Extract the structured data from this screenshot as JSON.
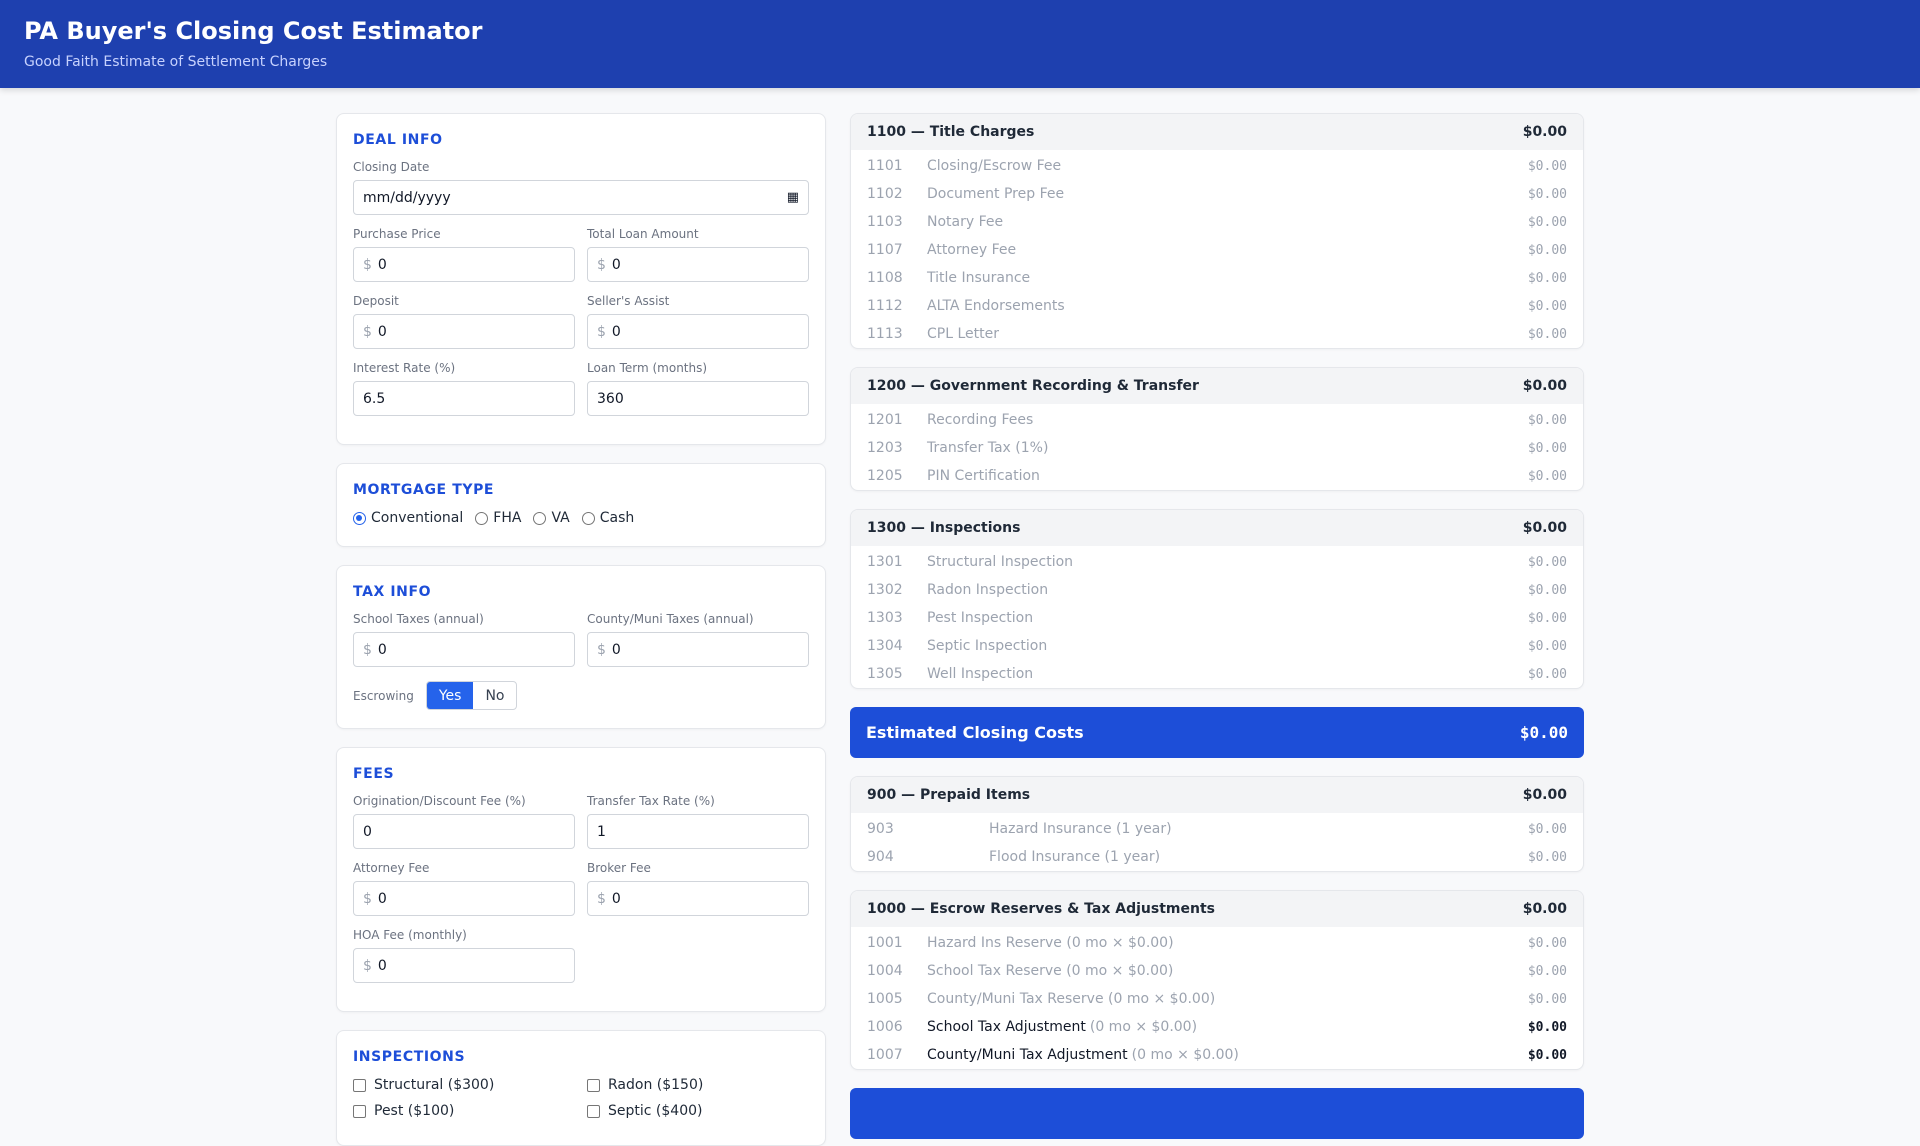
{
  "header": {
    "title": "PA Buyer's Closing Cost Estimator",
    "subtitle": "Good Faith Estimate of Settlement Charges"
  },
  "deal": {
    "heading": "DEAL INFO",
    "closing_date_label": "Closing Date",
    "closing_date_placeholder": "mm/dd/yyyy",
    "fields": [
      {
        "label": "Purchase Price",
        "value": "0",
        "currency": "$"
      },
      {
        "label": "Total Loan Amount",
        "value": "0",
        "currency": "$"
      },
      {
        "label": "Deposit",
        "value": "0",
        "currency": "$"
      },
      {
        "label": "Seller's Assist",
        "value": "0",
        "currency": "$"
      },
      {
        "label": "Interest Rate (%)",
        "value": "6.5"
      },
      {
        "label": "Loan Term (months)",
        "value": "360"
      }
    ]
  },
  "mortgage": {
    "heading": "MORTGAGE TYPE",
    "options": [
      "Conventional",
      "FHA",
      "VA",
      "Cash"
    ],
    "selected": "Conventional"
  },
  "tax": {
    "heading": "TAX INFO",
    "fields": [
      {
        "label": "School Taxes (annual)",
        "value": "0",
        "currency": "$"
      },
      {
        "label": "County/Muni Taxes (annual)",
        "value": "0",
        "currency": "$"
      }
    ],
    "escrowing_label": "Escrowing",
    "yes": "Yes",
    "no": "No",
    "escrowing": "Yes"
  },
  "fees": {
    "heading": "FEES",
    "fields": [
      {
        "label": "Origination/Discount Fee (%)",
        "value": "0"
      },
      {
        "label": "Transfer Tax Rate (%)",
        "value": "1"
      },
      {
        "label": "Attorney Fee",
        "value": "0",
        "currency": "$"
      },
      {
        "label": "Broker Fee",
        "value": "0",
        "currency": "$"
      },
      {
        "label": "HOA Fee (monthly)",
        "value": "0",
        "currency": "$"
      }
    ]
  },
  "inspections": {
    "heading": "INSPECTIONS",
    "items": [
      "Structural ($300)",
      "Radon ($150)",
      "Pest ($100)",
      "Septic ($400)"
    ]
  },
  "sections": {
    "title": {
      "heading": "1100 — Title Charges",
      "total": "$0.00",
      "rows": [
        {
          "code": "1101",
          "label": "Closing/Escrow Fee",
          "amount": "$0.00"
        },
        {
          "code": "1102",
          "label": "Document Prep Fee",
          "amount": "$0.00"
        },
        {
          "code": "1103",
          "label": "Notary Fee",
          "amount": "$0.00"
        },
        {
          "code": "1107",
          "label": "Attorney Fee",
          "amount": "$0.00"
        },
        {
          "code": "1108",
          "label": "Title Insurance",
          "amount": "$0.00"
        },
        {
          "code": "1112",
          "label": "ALTA Endorsements",
          "amount": "$0.00"
        },
        {
          "code": "1113",
          "label": "CPL Letter",
          "amount": "$0.00"
        }
      ]
    },
    "gov": {
      "heading": "1200 — Government Recording & Transfer",
      "total": "$0.00",
      "rows": [
        {
          "code": "1201",
          "label": "Recording Fees",
          "amount": "$0.00"
        },
        {
          "code": "1203",
          "label": "Transfer Tax (1%)",
          "amount": "$0.00"
        },
        {
          "code": "1205",
          "label": "PIN Certification",
          "amount": "$0.00"
        }
      ]
    },
    "insp": {
      "heading": "1300 — Inspections",
      "total": "$0.00",
      "rows": [
        {
          "code": "1301",
          "label": "Structural Inspection",
          "amount": "$0.00"
        },
        {
          "code": "1302",
          "label": "Radon Inspection",
          "amount": "$0.00"
        },
        {
          "code": "1303",
          "label": "Pest Inspection",
          "amount": "$0.00"
        },
        {
          "code": "1304",
          "label": "Septic Inspection",
          "amount": "$0.00"
        },
        {
          "code": "1305",
          "label": "Well Inspection",
          "amount": "$0.00"
        }
      ]
    },
    "estimated": {
      "label": "Estimated Closing Costs",
      "total": "$0.00"
    },
    "prepaid": {
      "heading": "900 — Prepaid Items",
      "total": "$0.00",
      "rows": [
        {
          "code": "903",
          "label": "Hazard Insurance (1 year)",
          "amount": "$0.00"
        },
        {
          "code": "904",
          "label": "Flood Insurance (1 year)",
          "amount": "$0.00"
        }
      ]
    },
    "escrow": {
      "heading": "1000 — Escrow Reserves & Tax Adjustments",
      "total": "$0.00",
      "rows": [
        {
          "code": "1001",
          "label": "Hazard Ins Reserve (0 mo × $0.00)",
          "amount": "$0.00"
        },
        {
          "code": "1004",
          "label": "School Tax Reserve (0 mo × $0.00)",
          "amount": "$0.00"
        },
        {
          "code": "1005",
          "label": "County/Muni Tax Reserve (0 mo × $0.00)",
          "amount": "$0.00"
        },
        {
          "code": "1006",
          "label": "School Tax Adjustment",
          "detail": "(0 mo × $0.00)",
          "amount": "$0.00"
        },
        {
          "code": "1007",
          "label": "County/Muni Tax Adjustment",
          "detail": "(0 mo × $0.00)",
          "amount": "$0.00"
        }
      ]
    }
  }
}
